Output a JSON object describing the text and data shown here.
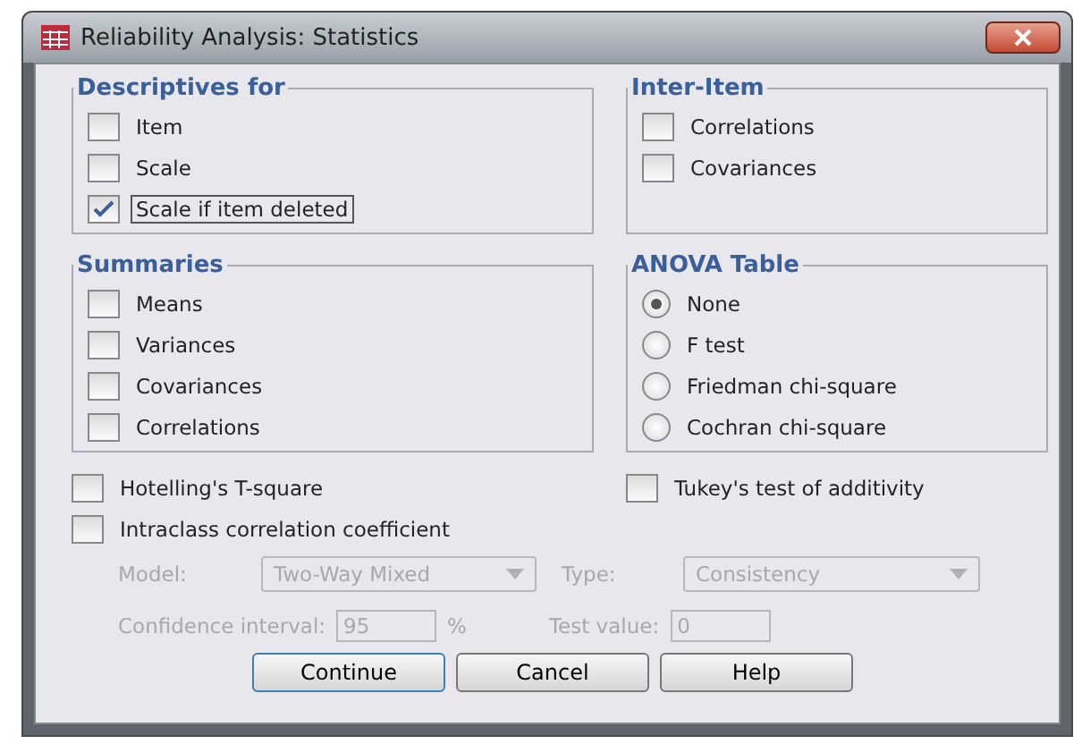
{
  "window": {
    "title": "Reliability Analysis: Statistics"
  },
  "descriptives": {
    "title": "Descriptives for",
    "items": [
      {
        "label": "Item",
        "checked": false,
        "focused": false
      },
      {
        "label": "Scale",
        "checked": false,
        "focused": false
      },
      {
        "label": "Scale if item deleted",
        "checked": true,
        "focused": true
      }
    ]
  },
  "inter_item": {
    "title": "Inter-Item",
    "items": [
      {
        "label": "Correlations",
        "checked": false
      },
      {
        "label": "Covariances",
        "checked": false
      }
    ]
  },
  "summaries": {
    "title": "Summaries",
    "items": [
      {
        "label": "Means",
        "checked": false
      },
      {
        "label": "Variances",
        "checked": false
      },
      {
        "label": "Covariances",
        "checked": false
      },
      {
        "label": "Correlations",
        "checked": false
      }
    ]
  },
  "anova": {
    "title": "ANOVA Table",
    "options": [
      {
        "label": "None",
        "selected": true
      },
      {
        "label": "F test",
        "selected": false
      },
      {
        "label": "Friedman chi-square",
        "selected": false
      },
      {
        "label": "Cochran chi-square",
        "selected": false
      }
    ]
  },
  "hotelling": {
    "label": "Hotelling's T-square",
    "checked": false
  },
  "tukey": {
    "label": "Tukey's test of additivity",
    "checked": false
  },
  "intraclass": {
    "label": "Intraclass correlation coefficient",
    "checked": false
  },
  "icc": {
    "disabled": true,
    "model_label": "Model:",
    "model_value": "Two-Way Mixed",
    "type_label": "Type:",
    "type_value": "Consistency",
    "ci_label": "Confidence interval:",
    "ci_value": "95",
    "ci_unit": "%",
    "test_label": "Test value:",
    "test_value": "0"
  },
  "buttons": [
    {
      "label": "Continue",
      "default": true
    },
    {
      "label": "Cancel",
      "default": false
    },
    {
      "label": "Help",
      "default": false
    }
  ]
}
